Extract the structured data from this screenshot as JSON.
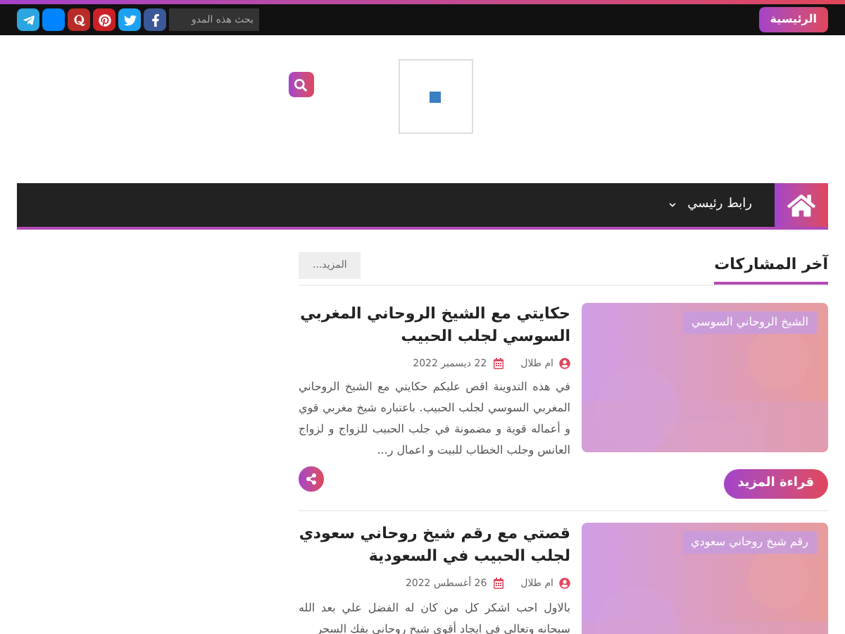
{
  "top_bar": {
    "home_link": "الرئيسية",
    "search": {
      "placeholder": "بحث هذه المدو"
    },
    "social": [
      {
        "kind": "facebook",
        "color": "#3b5998"
      },
      {
        "kind": "twitter",
        "color": "#1da1f2"
      },
      {
        "kind": "pinterest",
        "color": "#cb2027"
      },
      {
        "kind": "quora",
        "color": "#b92b27"
      },
      {
        "kind": "blank",
        "color": "#0084ff"
      },
      {
        "kind": "telegram",
        "color": "#2ca5e0"
      }
    ]
  },
  "nav": {
    "items": [
      {
        "label": "رابط رئيسي",
        "has_dropdown": true
      }
    ]
  },
  "section": {
    "title": "آخر المشاركات",
    "more": "المزيد..."
  },
  "posts": [
    {
      "label": "الشيخ الروحاني السوسي",
      "title": "حكايتي مع الشيخ الروحاني المغربي السوسي لجلب الحبيب",
      "author": "ام طلال",
      "date": "22 ديسمبر 2022",
      "excerpt": "في هذه التدوينة اقص عليكم حكايتي مع الشيخ الروحاني المغربي السوسي لجلب الحبيب. باعتباره شيخ مغربي قوي و أعماله قوية و مضمونة في جلب الحبيب للزواج و لزواج العانس وجلب الخطاب للبيت و اعمال ر...",
      "read_more": "قراءة المزيد"
    },
    {
      "label": "رقم شيخ روحاني سعودي",
      "title": "قصتي مع رقم شيخ روحاني سعودي لجلب الحبيب في السعودية",
      "author": "ام طلال",
      "date": "26 أغسطس 2022",
      "excerpt": "بالاول احب اشكر كل من كان له الفضل علي بعد الله سبحانه وتعالى في ايجاد أقوى شيخ روحاني بفك السحر"
    }
  ]
}
